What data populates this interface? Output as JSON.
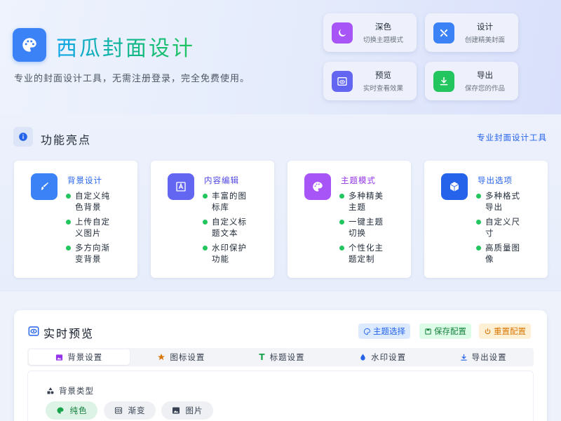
{
  "header": {
    "title": "西瓜封面设计",
    "subtitle": "专业的封面设计工具，无需注册登录，完全免费使用。",
    "logo_icon": "palette-icon"
  },
  "quick_actions": [
    {
      "title": "深色",
      "subtitle": "切换主题模式",
      "icon": "moon-icon",
      "color": "#a855f7"
    },
    {
      "title": "设计",
      "subtitle": "创建精美封面",
      "icon": "tools-icon",
      "color": "#3b82f6"
    },
    {
      "title": "预览",
      "subtitle": "实时查看效果",
      "icon": "eye-icon",
      "color": "#6366f1"
    },
    {
      "title": "导出",
      "subtitle": "保存您的作品",
      "icon": "download-icon",
      "color": "#22c55e"
    }
  ],
  "features": {
    "title": "功能亮点",
    "link": "专业封面设计工具",
    "cards": [
      {
        "title": "背景设计",
        "color": "#3b82f6",
        "icon": "brush-icon",
        "items": [
          "自定义纯色背景",
          "上传自定义图片",
          "多方向渐变背景"
        ]
      },
      {
        "title": "内容编辑",
        "color": "#6366f1",
        "icon": "text-frame-icon",
        "items": [
          "丰富的图标库",
          "自定义标题文本",
          "水印保护功能"
        ]
      },
      {
        "title": "主题模式",
        "color": "#a855f7",
        "icon": "palette-icon",
        "items": [
          "多种精美主题",
          "一键主题切换",
          "个性化主题定制"
        ]
      },
      {
        "title": "导出选项",
        "color": "#2563eb",
        "icon": "cube-icon",
        "items": [
          "多种格式导出",
          "自定义尺寸",
          "高质量图像"
        ]
      }
    ]
  },
  "preview": {
    "title": "实时预览",
    "buttons": [
      {
        "label": "主题选择",
        "icon": "palette-icon",
        "bg": "#dbeafe",
        "fg": "#2563eb"
      },
      {
        "label": "保存配置",
        "icon": "save-icon",
        "bg": "#dcfce7",
        "fg": "#15803d"
      },
      {
        "label": "重置配置",
        "icon": "power-icon",
        "bg": "#fdf0d5",
        "fg": "#d97706"
      }
    ],
    "tabs": [
      {
        "label": "背景设置",
        "icon": "image-icon",
        "active": true
      },
      {
        "label": "图标设置",
        "icon": "star-icon",
        "active": false
      },
      {
        "label": "标题设置",
        "icon": "text-icon",
        "active": false
      },
      {
        "label": "水印设置",
        "icon": "drop-icon",
        "active": false
      },
      {
        "label": "导出设置",
        "icon": "download-icon",
        "active": false
      }
    ],
    "panel": {
      "label": "背景类型",
      "options": [
        {
          "label": "纯色",
          "icon": "palette-icon",
          "selected": true
        },
        {
          "label": "渐变",
          "icon": "gradient-icon",
          "selected": false
        },
        {
          "label": "图片",
          "icon": "image-icon",
          "selected": false
        }
      ]
    }
  }
}
